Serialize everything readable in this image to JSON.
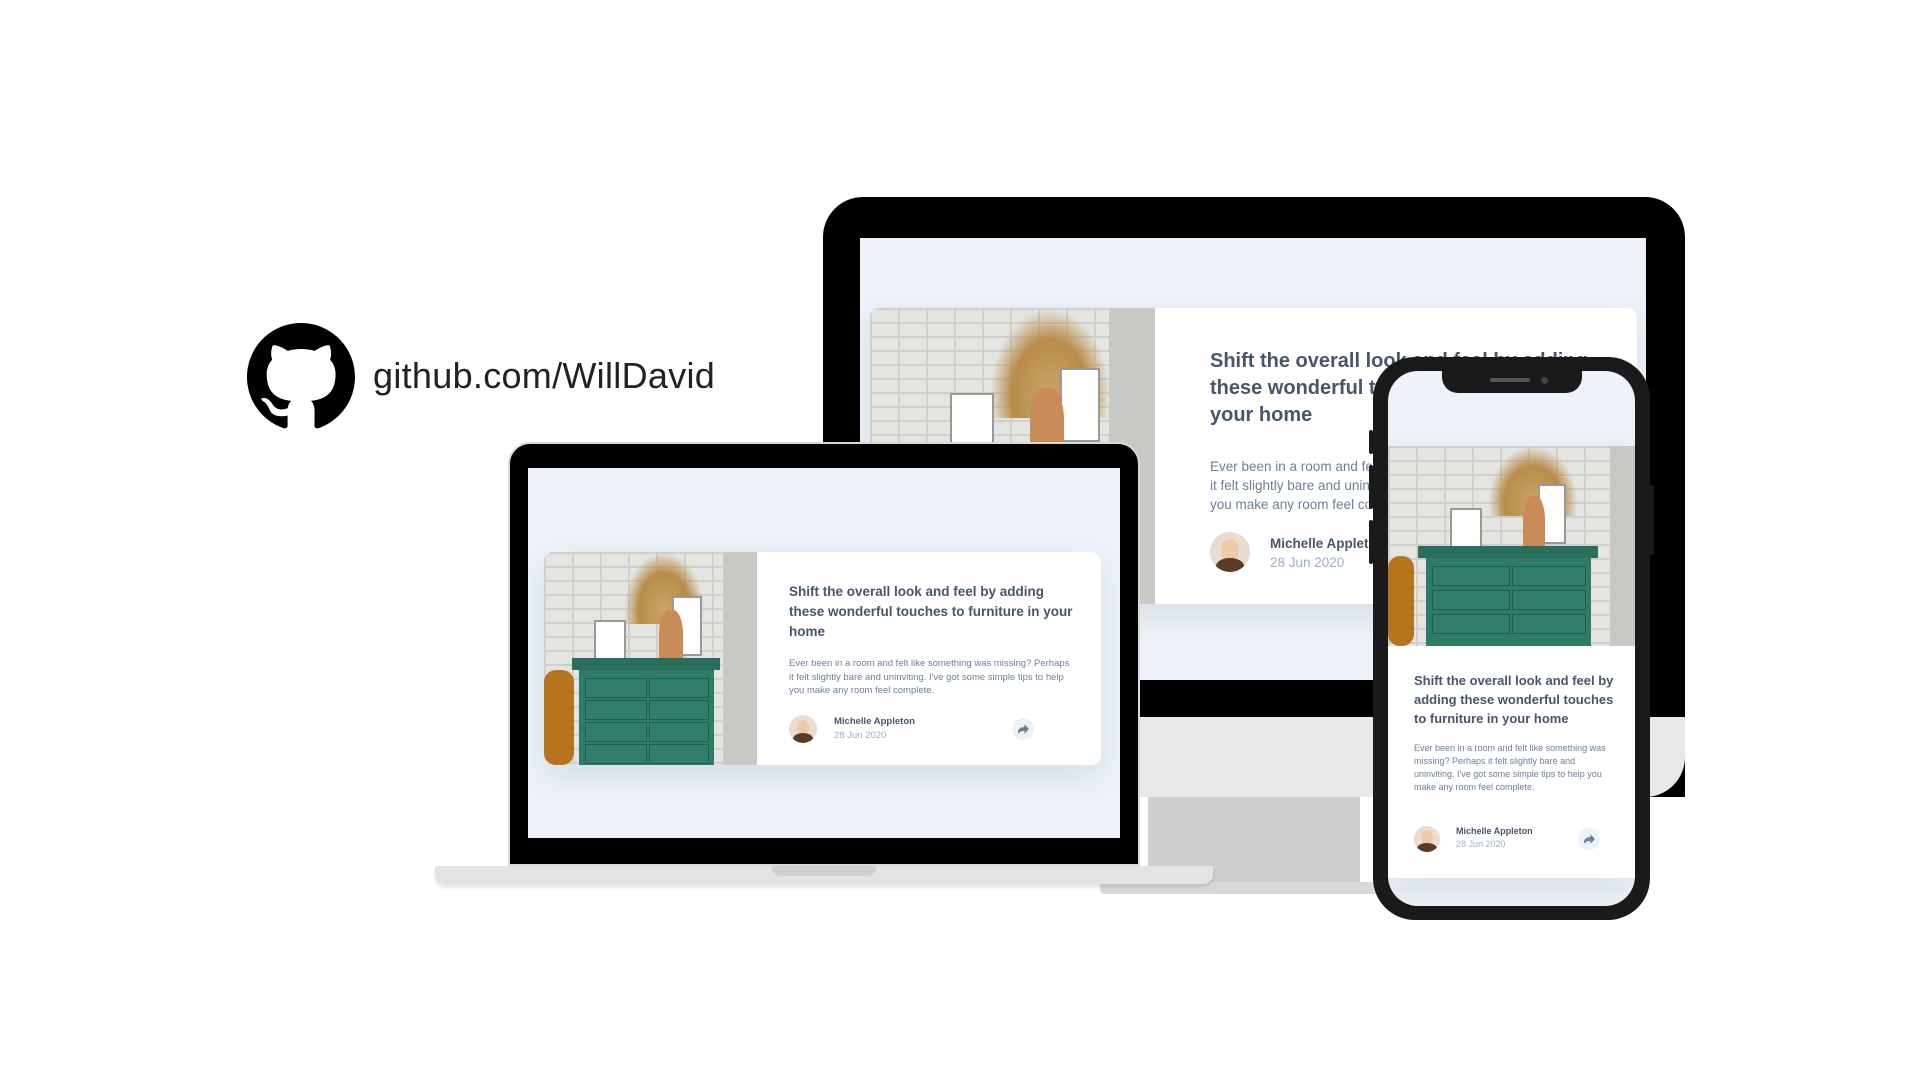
{
  "github": {
    "label": "github.com/WillDavid",
    "icon": "github-icon"
  },
  "card": {
    "title": "Shift the overall look and feel by adding these wonderful touches to furniture in your home",
    "description": "Ever been in a room and felt like something was missing? Perhaps it felt slightly bare and uninviting. I've got some simple tips to help you make any room feel complete.",
    "author_name": "Michelle Appleton",
    "date": "28 Jun 2020",
    "share_icon": "share-icon"
  },
  "colors": {
    "page_bg": "#ecf2f8",
    "title": "#48556a",
    "body": "#6d7f97",
    "date": "#9eafc2",
    "dresser": "#2e7b66"
  }
}
